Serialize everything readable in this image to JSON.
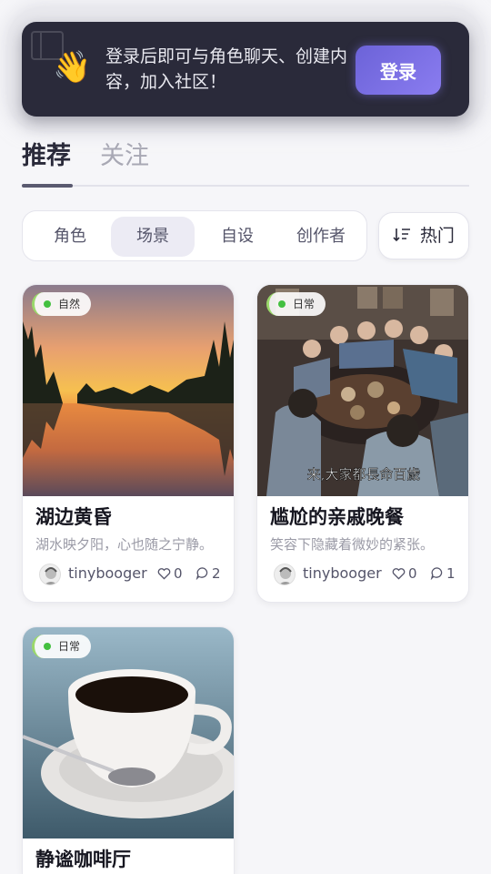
{
  "banner": {
    "message": "登录后即可与角色聊天、创建内容，加入社区！",
    "login_label": "登录",
    "emoji": "👋"
  },
  "main_tabs": [
    {
      "label": "推荐",
      "active": true
    },
    {
      "label": "关注",
      "active": false
    }
  ],
  "filters": [
    {
      "label": "角色",
      "selected": false
    },
    {
      "label": "场景",
      "selected": true
    },
    {
      "label": "自设",
      "selected": false
    },
    {
      "label": "创作者",
      "selected": false
    }
  ],
  "sort": {
    "label": "热门",
    "icon": "sort-descending-icon"
  },
  "cards": [
    {
      "tag": "自然",
      "title": "湖边黄昏",
      "desc": "湖水映夕阳，心也随之宁静。",
      "author": "tinybooger",
      "likes": "0",
      "comments": "2",
      "image": "sunset-lake"
    },
    {
      "tag": "日常",
      "title": "尴尬的亲戚晚餐",
      "desc": "笑容下隐藏着微妙的紧张。",
      "author": "tinybooger",
      "likes": "0",
      "comments": "1",
      "image": "family-dinner",
      "image_caption": "来,大家都長命百歲"
    },
    {
      "tag": "日常",
      "title": "静谧咖啡厅",
      "image": "coffee-cup"
    }
  ],
  "colors": {
    "banner_bg": "#2a2a3a",
    "accent": "#7a70e6",
    "tag_dot": "#44c040"
  }
}
